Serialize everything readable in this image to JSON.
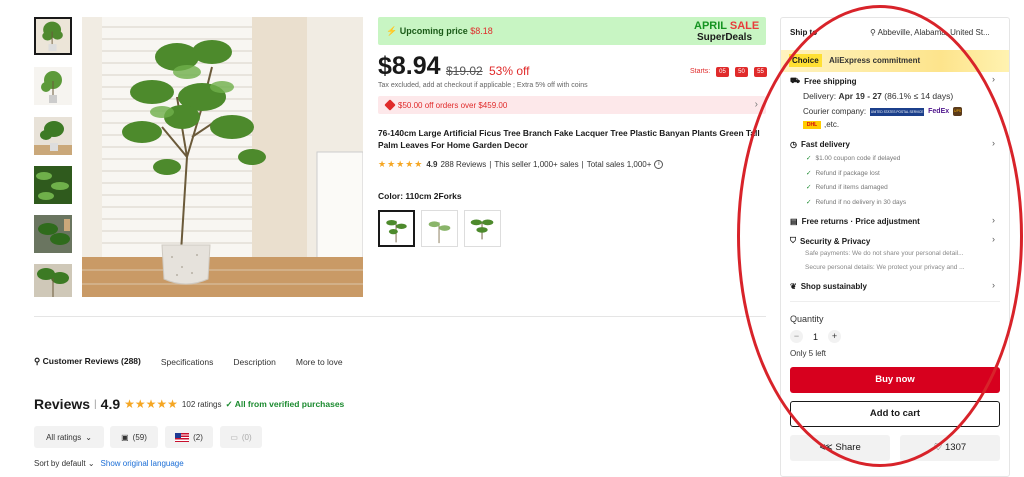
{
  "banner": {
    "upcoming_label": "Upcoming price",
    "upcoming_price": "$8.18",
    "sale_word1": "APRIL",
    "sale_word2": "SALE",
    "sale_sub": "SuperDeals"
  },
  "price": {
    "current": "$8.94",
    "original": "$19.02",
    "discount": "53% off",
    "starts_label": "Starts:",
    "countdown": [
      "05",
      "50",
      "55"
    ],
    "tax_note": "Tax excluded, add at checkout if applicable ; Extra 5% off with coins"
  },
  "coupon": {
    "text": "$50.00 off orders over $459.00"
  },
  "product": {
    "title": "76-140cm Large Artificial Ficus Tree Branch Fake Lacquer Tree Plastic Banyan Plants Green Tall Palm Leaves For Home Garden Decor",
    "rating_stars": "★★★★★",
    "rating": "4.9",
    "reviews": "288 Reviews",
    "sep": "|",
    "seller_sales": "This seller 1,000+ sales",
    "total_sales": "Total sales 1,000+"
  },
  "color": {
    "label": "Color: 110cm 2Forks"
  },
  "tabs": {
    "customer_reviews": "Customer Reviews (288)",
    "specifications": "Specifications",
    "description": "Description",
    "more": "More to love"
  },
  "reviews": {
    "heading": "Reviews",
    "sep": "|",
    "score": "4.9",
    "stars": "★★★★★",
    "ratings": "102 ratings",
    "verified": "All from verified purchases"
  },
  "filters": {
    "all": "All ratings",
    "photos": "(59)",
    "country": "(2)",
    "comments": "(0)"
  },
  "sort": {
    "label": "Sort by default",
    "show_original": "Show original language"
  },
  "panel": {
    "ship_to": "Ship to",
    "location": "Abbeville, Alabama, United St...",
    "choice": "Choice",
    "commitment": "AliExpress commitment",
    "free_shipping": "Free shipping",
    "delivery_label": "Delivery:",
    "delivery_dates": "Apr 19 - 27",
    "delivery_note": "(86.1% ≤ 14 days)",
    "courier_label": "Courier company:",
    "courier_usps": "UNITED STATES POSTAL SERVICE",
    "courier_fedex": "FedEx",
    "courier_ups": "UPS",
    "courier_dhl": "DHL",
    "etc": ",etc.",
    "fast_delivery": "Fast delivery",
    "fast_items": [
      "$1.00 coupon code if delayed",
      "Refund if package lost",
      "Refund if items damaged",
      "Refund if no delivery in 30 days"
    ],
    "free_returns": "Free returns · Price adjustment",
    "security": "Security & Privacy",
    "security_lines": [
      "Safe payments: We do not share your personal detail...",
      "Secure personal details: We protect your privacy and ..."
    ],
    "sustainable": "Shop sustainably",
    "quantity_label": "Quantity",
    "quantity": "1",
    "only_left": "Only 5 left",
    "buy_now": "Buy now",
    "add_to_cart": "Add to cart",
    "share": "Share",
    "wishlist": "1307"
  },
  "colors": {
    "accent": "#e02b2b",
    "buy": "#d7001e",
    "banner": "#c8f5c3",
    "annotation": "#d8232a"
  }
}
